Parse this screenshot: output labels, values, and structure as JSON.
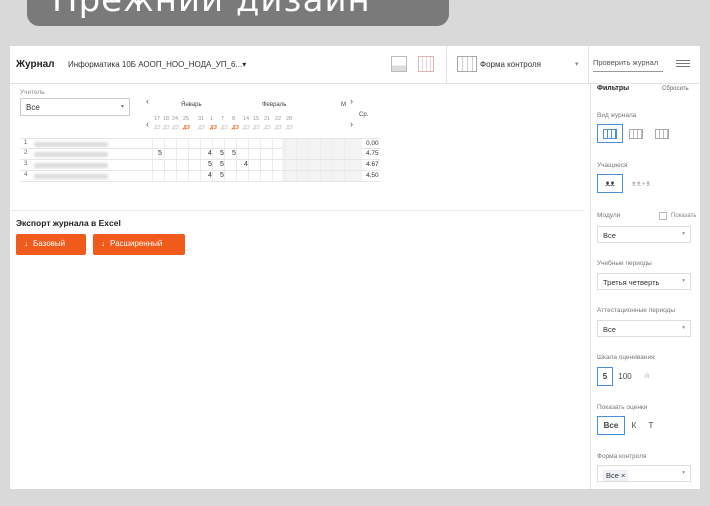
{
  "banner": "Прежний дизайн",
  "header": {
    "title": "Журнал",
    "course": "Информатика 10Б АООП_НОО_НОДА_УП_6...",
    "course_caret": "▾",
    "form_select": "Форма контроля",
    "check_button": "Проверить журнал"
  },
  "journal": {
    "teacher_label": "Учитель",
    "teacher_value": "Все",
    "months": [
      "Январь",
      "Февраль",
      "М"
    ],
    "days": [
      "17",
      "18",
      "24",
      "25",
      "31",
      "1",
      "7",
      "8",
      "14",
      "15",
      "21",
      "22",
      "28"
    ],
    "types": [
      "ДЗ",
      "ДЗ",
      "ДЗ",
      "ДЗ",
      "ДЗ",
      "ДЗ",
      "ДЗ",
      "ДЗ",
      "ДЗ",
      "ДЗ",
      "ДЗ",
      "ДЗ",
      "ДЗ"
    ],
    "avg_header": "Ср.",
    "rows": [
      {
        "num": "1",
        "marks": [
          "",
          "",
          "",
          "",
          "",
          "",
          ""
        ],
        "avg": "0.00"
      },
      {
        "num": "2",
        "marks": [
          "5",
          "",
          "4",
          "5",
          "5",
          "",
          ""
        ],
        "avg": "4.75"
      },
      {
        "num": "3",
        "marks": [
          "",
          "",
          "5",
          "5",
          "",
          "4",
          ""
        ],
        "avg": "4.67"
      },
      {
        "num": "4",
        "marks": [
          "",
          "",
          "4",
          "5",
          "",
          "",
          ""
        ],
        "avg": "4.50"
      }
    ]
  },
  "export": {
    "title": "Экспорт журнала в Excel",
    "basic": "Базовый",
    "extended": "Расширенный"
  },
  "filters": {
    "title": "Фильтры",
    "reset": "Сбросить",
    "journal_view_label": "Вид журнала",
    "students_label": "Учащиеся",
    "modules_label": "Модули",
    "show_label": "Показать",
    "modules_value": "Все",
    "periods_label": "Учебные периоды",
    "periods_value": "Третья четверть",
    "attest_label": "Аттестационные периоды",
    "attest_value": "Все",
    "scale_label": "Шкала оценивания",
    "scale_5": "5",
    "scale_100": "100",
    "show_marks_label": "Показать оценки",
    "marks_all": "Все",
    "marks_k": "К",
    "marks_t": "Т",
    "form_label": "Форма контроля",
    "form_value": "Все",
    "form_remove": "×"
  },
  "icons": {
    "caret": "▾",
    "left": "‹",
    "right": "›",
    "download": "↓",
    "students_single": "ᴥᴥ",
    "students_plus": "ᴥᴥ+ᴥ",
    "scale_chart": "ılı"
  }
}
